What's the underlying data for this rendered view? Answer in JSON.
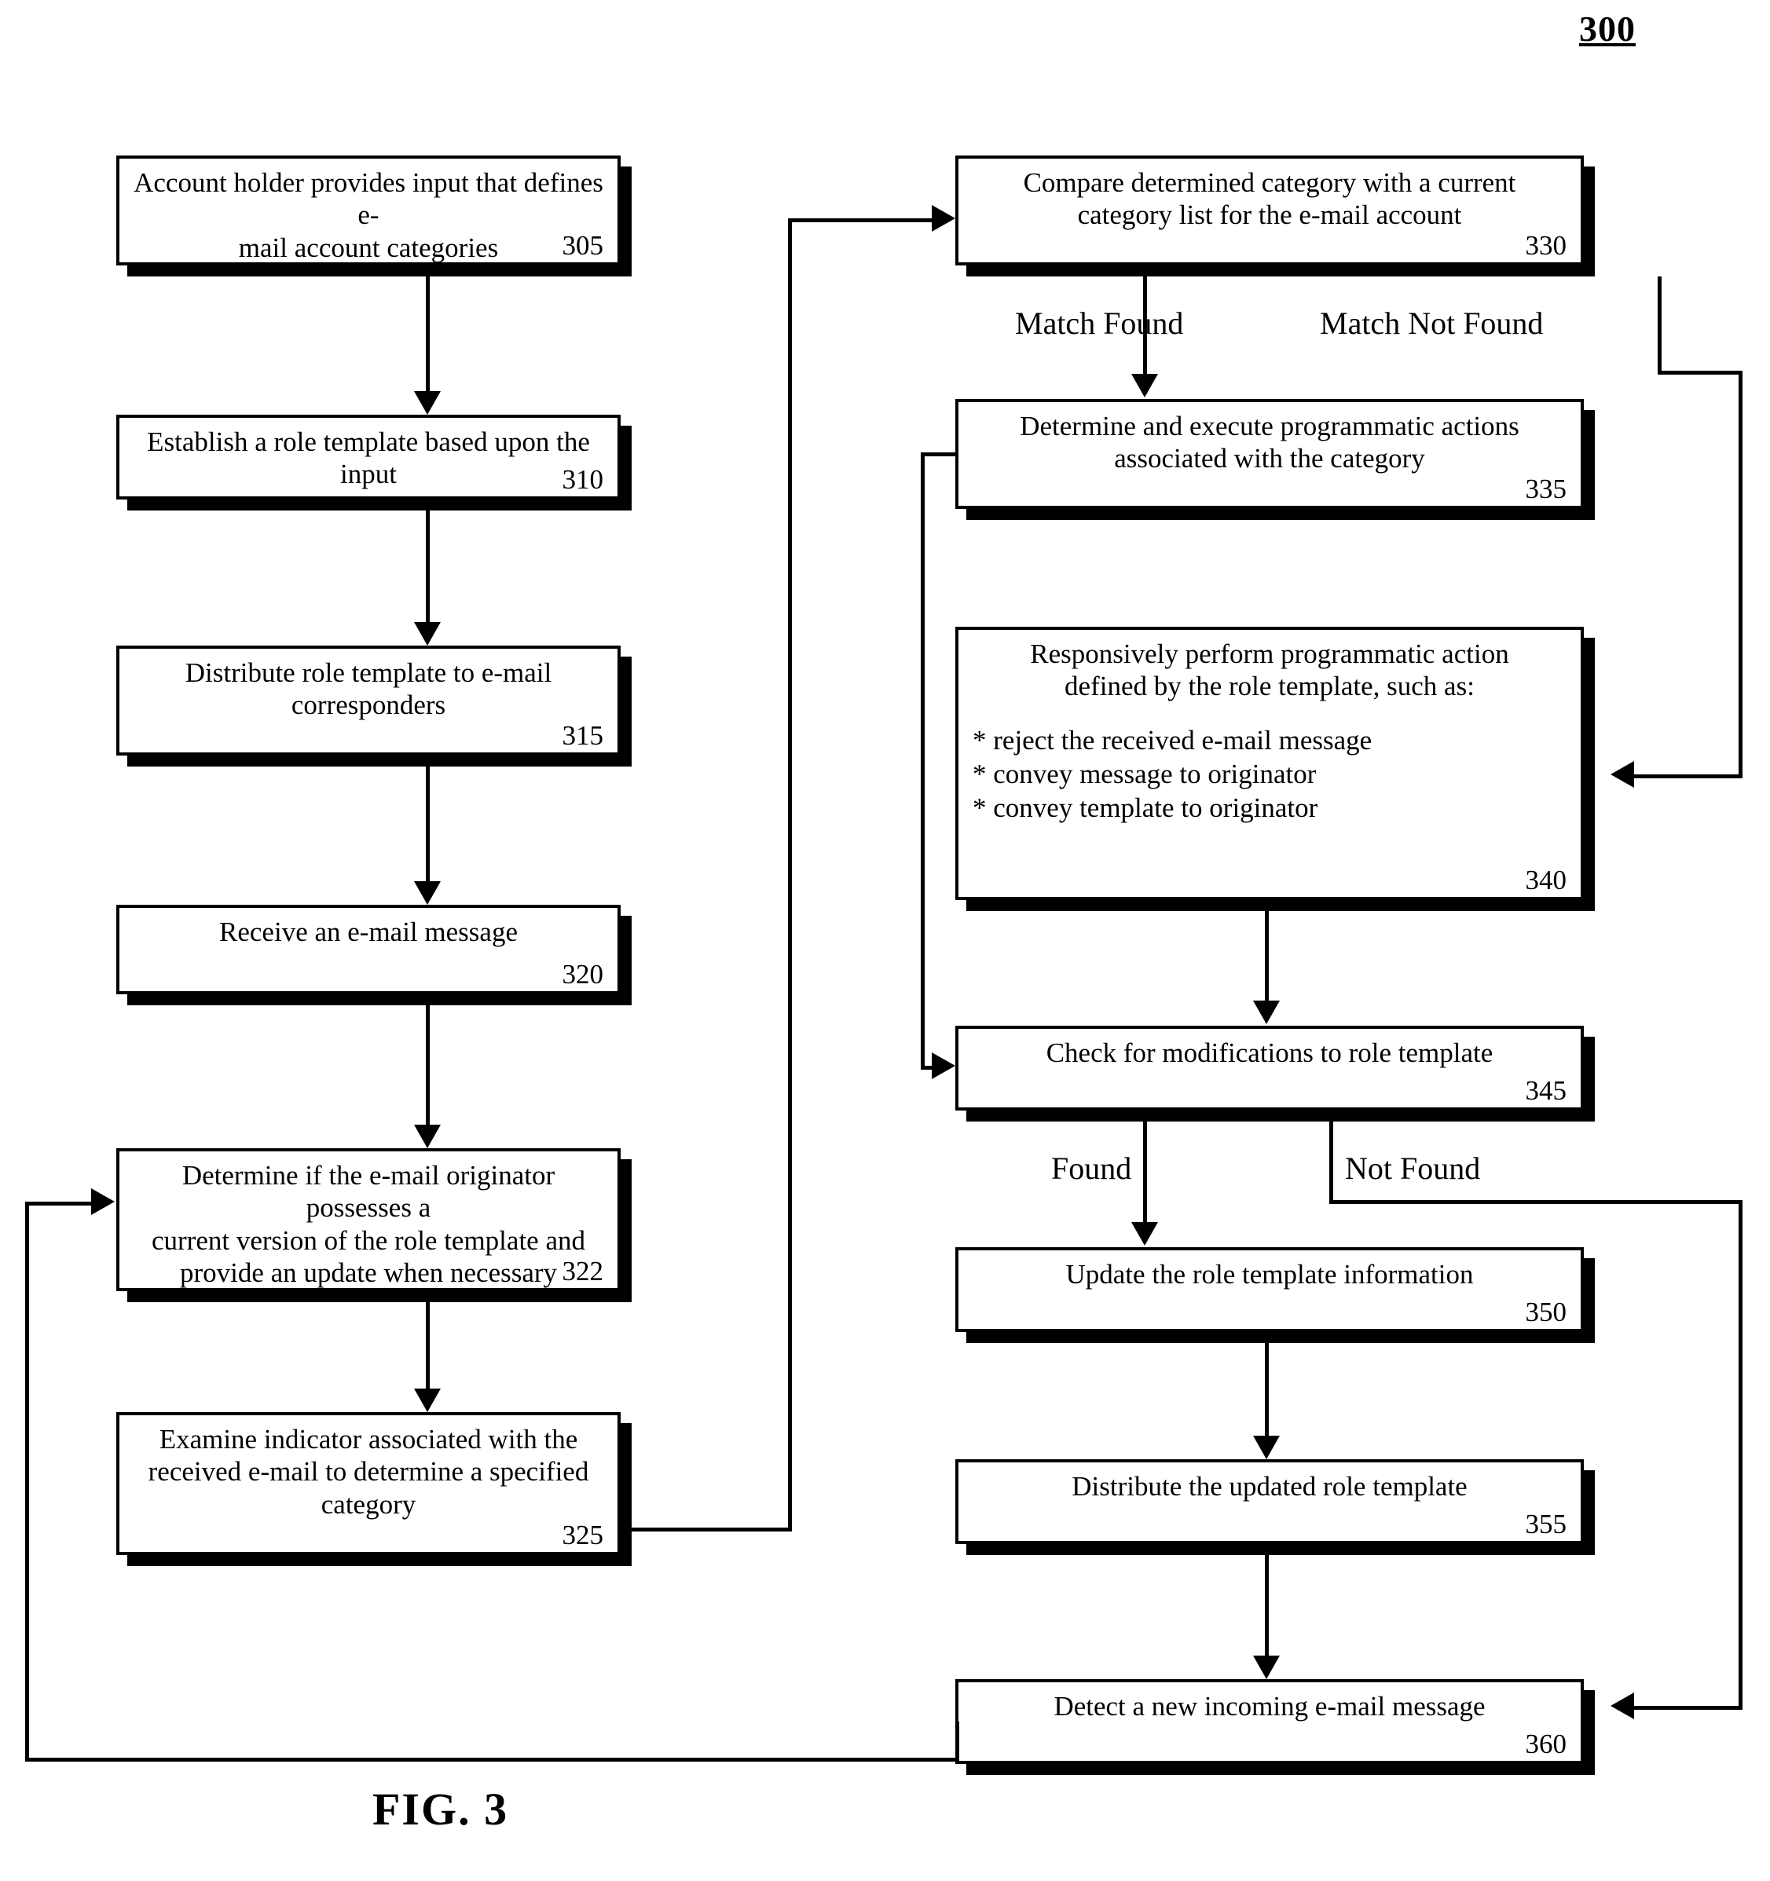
{
  "figure": {
    "number": "300",
    "caption": "FIG. 3"
  },
  "nodes": [
    {
      "id": "n305",
      "ref": "305",
      "text": "Account holder provides input that defines e-\nmail account categories"
    },
    {
      "id": "n310",
      "ref": "310",
      "text": "Establish a role template based upon the input"
    },
    {
      "id": "n315",
      "ref": "315",
      "text": "Distribute role template to e-mail\ncorresponders"
    },
    {
      "id": "n320",
      "ref": "320",
      "text": "Receive an e-mail message"
    },
    {
      "id": "n322",
      "ref": "322",
      "text": "Determine if the e-mail originator possesses a\ncurrent version of the role template and\nprovide an update when necessary"
    },
    {
      "id": "n325",
      "ref": "325",
      "text": "Examine indicator associated with the\nreceived e-mail to determine a specified\ncategory"
    },
    {
      "id": "n330",
      "ref": "330",
      "text": "Compare determined category with a current\ncategory list for the e-mail account"
    },
    {
      "id": "n335",
      "ref": "335",
      "text": "Determine and execute programmatic actions\nassociated with the category"
    },
    {
      "id": "n340",
      "ref": "340",
      "text": "Responsively perform programmatic action\ndefined by the role template, such as:",
      "bullets": "* reject the received e-mail message\n* convey message to originator\n* convey template to originator"
    },
    {
      "id": "n345",
      "ref": "345",
      "text": "Check for modifications to role template"
    },
    {
      "id": "n350",
      "ref": "350",
      "text": "Update the role template information"
    },
    {
      "id": "n355",
      "ref": "355",
      "text": "Distribute the updated role template"
    },
    {
      "id": "n360",
      "ref": "360",
      "text": "Detect a new incoming e-mail message"
    }
  ],
  "edge_labels": {
    "match_found": "Match Found",
    "match_not_found": "Match Not Found",
    "found": "Found",
    "not_found": "Not Found"
  }
}
